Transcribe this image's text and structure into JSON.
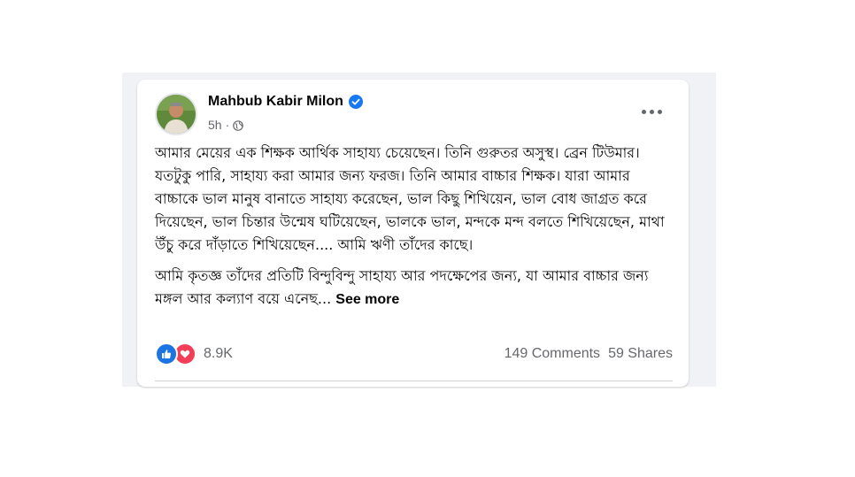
{
  "post": {
    "author": {
      "name": "Mahbub Kabir Milon",
      "verified_icon": "verified-badge-icon",
      "avatar_icon": "profile-photo"
    },
    "meta": {
      "time": "5h",
      "separator": "·",
      "audience_icon": "globe-icon"
    },
    "more_icon": "more-options-icon",
    "body": {
      "paragraph_1": "আমার মেয়ের এক শিক্ষক আর্থিক সাহায্য চেয়েছেন। তিনি গুরুতর অসুস্থ। ব্রেন টিউমার। যতটুকু পারি, সাহায্য করা আমার জন্য ফরজ। তিনি আমার বাচ্চার শিক্ষক। যারা আমার বাচ্চাকে ভাল মানুষ বানাতে সাহায্য করেছেন, ভাল কিছু শিখিয়েন, ভাল বোধ জাগ্রত করে দিয়েছেন, ভাল চিন্তার উন্মেষ ঘটিয়েছেন, ভালকে ভাল, মন্দকে মন্দ বলতে শিখিয়েছেন, মাথা উঁচু করে দাঁড়াতে শিখিয়েছেন.... আমি ঋণী তাঁদের কাছে।",
      "paragraph_2": "আমি কৃতজ্ঞ তাঁদের প্রতিটি বিন্দুবিন্দু সাহায্য আর পদক্ষেপের জন্য, যা আমার বাচ্চার জন্য মঙ্গল আর কল্যাণ বয়ে এনেছ...",
      "see_more": "See more"
    },
    "reactions": {
      "icons": [
        "like-icon",
        "love-icon"
      ],
      "count": "8.9K"
    },
    "stats": {
      "comments": "149 Comments",
      "shares": "59 Shares"
    }
  },
  "colors": {
    "feed_background": "#f0f2f5",
    "card_background": "#ffffff",
    "primary_text": "#050505",
    "secondary_text": "#65676b",
    "like_blue": "#1b74e4",
    "love_red": "#f33e58",
    "verified_blue": "#1877f2"
  }
}
